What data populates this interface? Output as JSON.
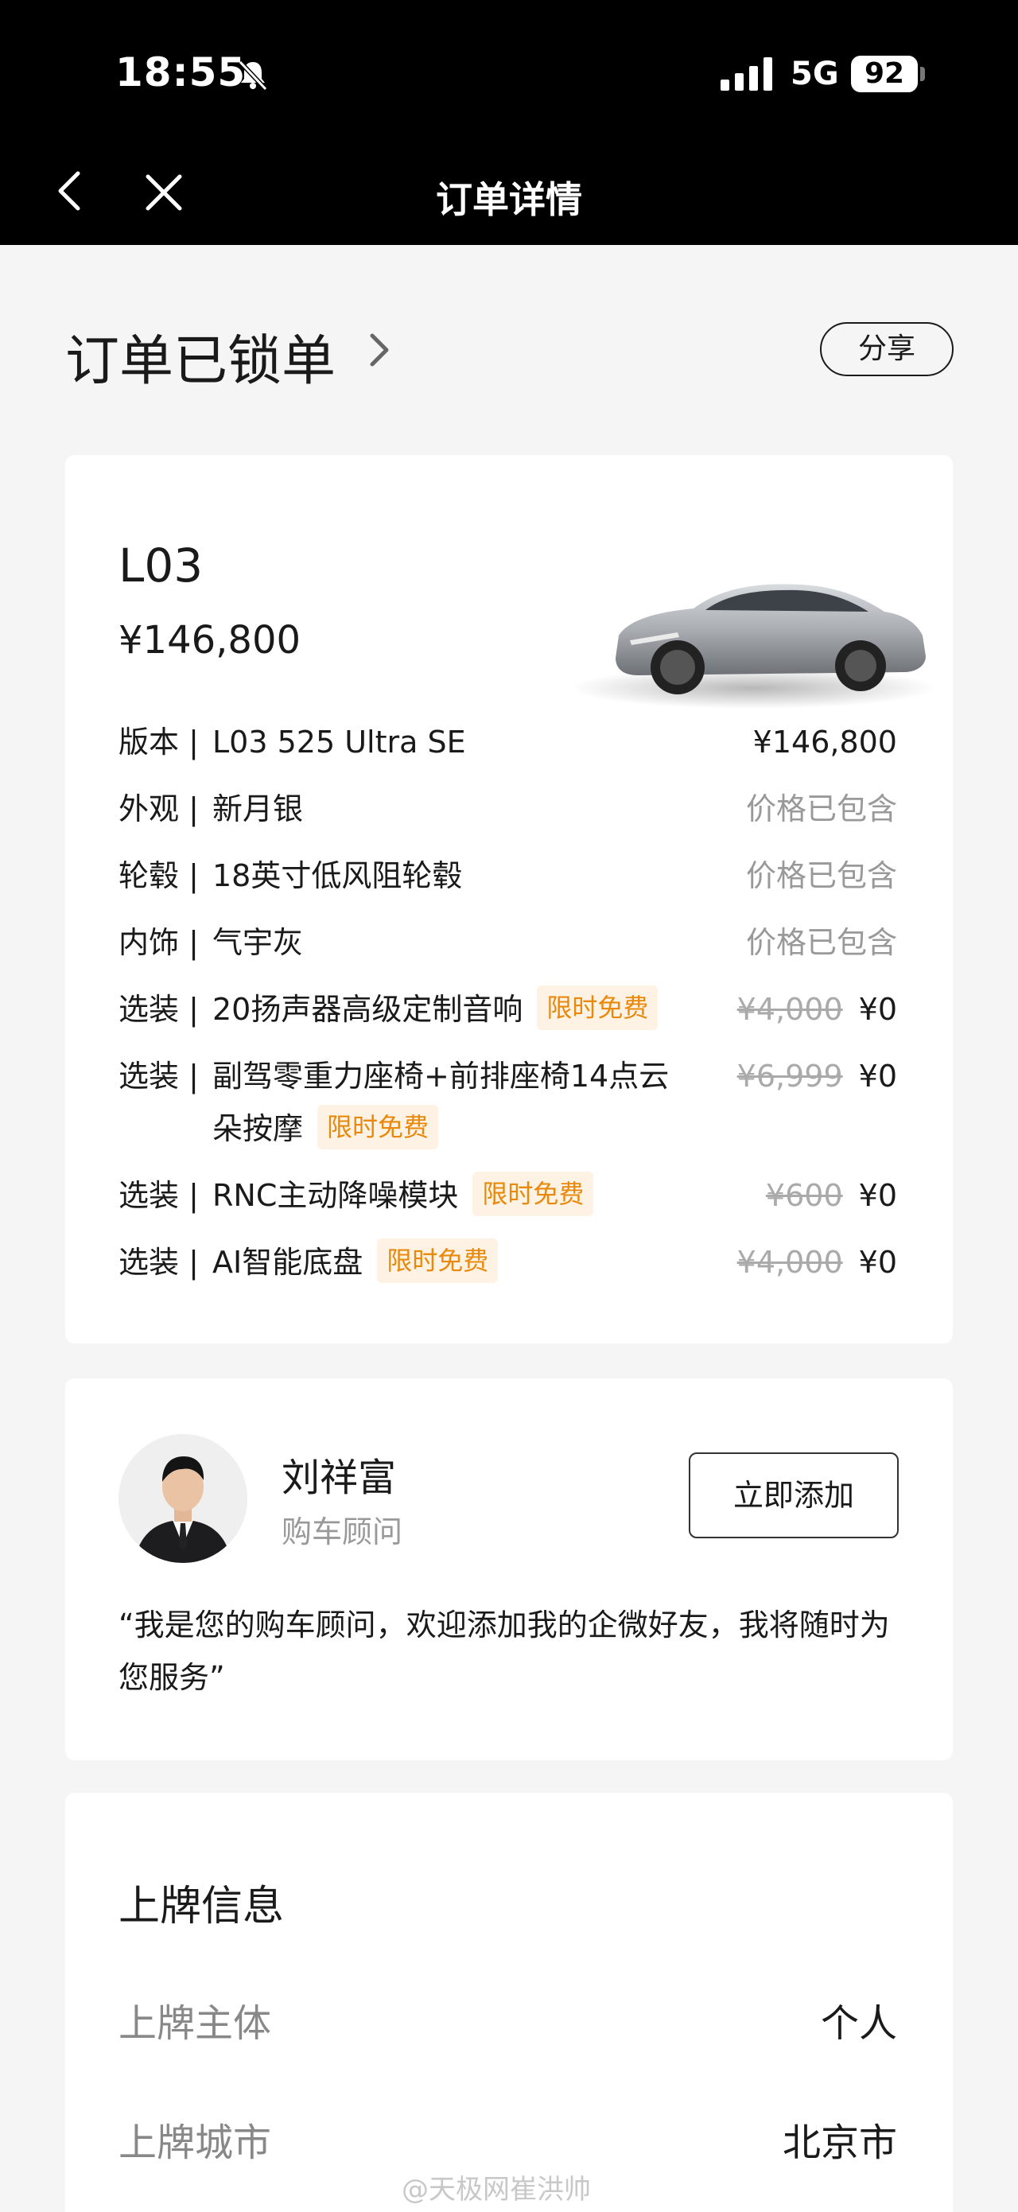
{
  "status_bar": {
    "time": "18:55",
    "network": "5G",
    "battery": "92"
  },
  "nav": {
    "title": "订单详情"
  },
  "order": {
    "status": "订单已锁单",
    "share_label": "分享"
  },
  "car": {
    "model": "L03",
    "price": "¥146,800",
    "config": [
      {
        "category": "版本 |",
        "name": "L03 525 Ultra SE",
        "price": "¥146,800"
      },
      {
        "category": "外观 |",
        "name": "新月银",
        "price": "价格已包含"
      },
      {
        "category": "轮毂 |",
        "name": "18英寸低风阻轮毂",
        "price": "价格已包含"
      },
      {
        "category": "内饰 |",
        "name": "气宇灰",
        "price": "价格已包含"
      },
      {
        "category": "选装 |",
        "name": "20扬声器高级定制音响",
        "tag": "限时免费",
        "original_price": "¥4,000",
        "price": "¥0"
      },
      {
        "category": "选装 |",
        "name": "副驾零重力座椅+前排座椅14点云朵按摩",
        "tag": "限时免费",
        "original_price": "¥6,999",
        "price": "¥0"
      },
      {
        "category": "选装 |",
        "name": "RNC主动降噪模块",
        "tag": "限时免费",
        "original_price": "¥600",
        "price": "¥0"
      },
      {
        "category": "选装 |",
        "name": "AI智能底盘",
        "tag": "限时免费",
        "original_price": "¥4,000",
        "price": "¥0"
      }
    ]
  },
  "advisor": {
    "name": "刘祥富",
    "role": "购车顾问",
    "add_label": "立即添加",
    "quote": "“我是您的购车顾问，欢迎添加我的企微好友，我将随时为您服务”"
  },
  "plate": {
    "title": "上牌信息",
    "rows": [
      {
        "label": "上牌主体",
        "value": "个人"
      },
      {
        "label": "上牌城市",
        "value": "北京市"
      }
    ]
  },
  "watermark": "@天极网崔洪帅",
  "colors": {
    "accent_tag_bg": "#fdf2e3",
    "accent_tag_text": "#e8890c",
    "topbar": "#000000"
  }
}
